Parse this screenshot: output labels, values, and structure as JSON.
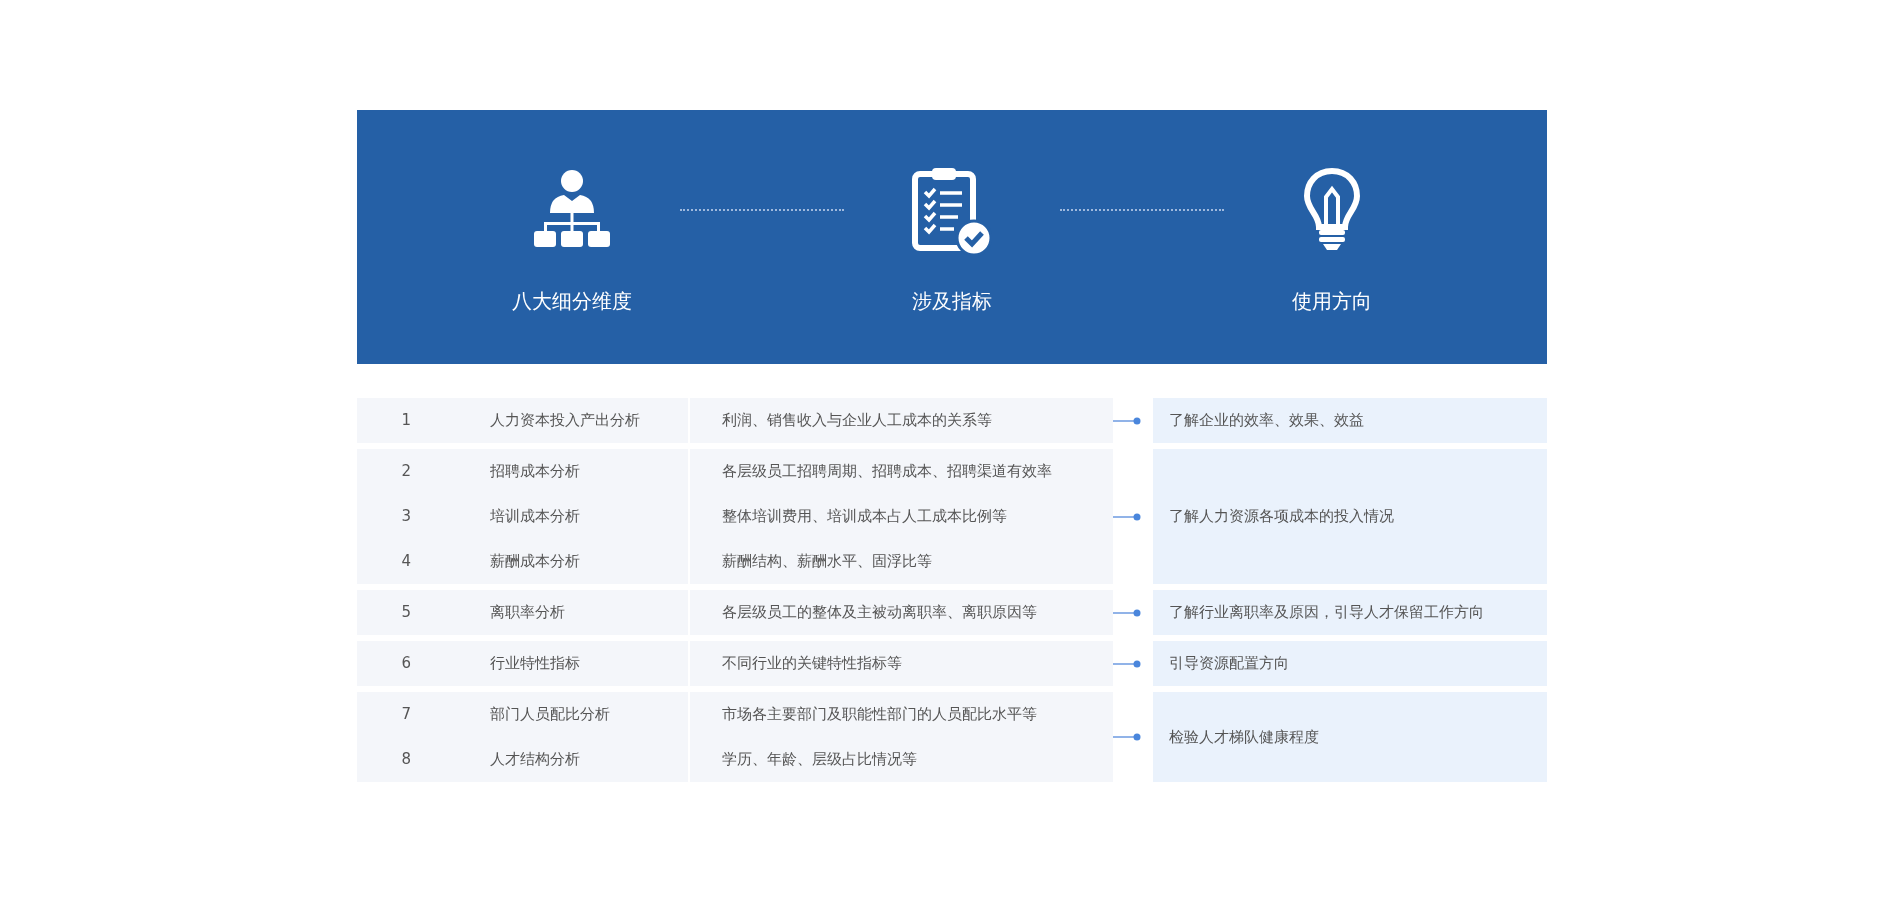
{
  "header": {
    "columns": [
      {
        "kind": "org",
        "label": "八大细分维度"
      },
      {
        "kind": "checklist",
        "label": "涉及指标"
      },
      {
        "kind": "bulb",
        "label": "使用方向"
      }
    ]
  },
  "groups": [
    {
      "rows": [
        {
          "number": "1",
          "name": "人力资本投入产出分析",
          "indicator": "利润、销售收入与企业人工成本的关系等"
        }
      ],
      "usage": "了解企业的效率、效果、效益"
    },
    {
      "rows": [
        {
          "number": "2",
          "name": "招聘成本分析",
          "indicator": "各层级员工招聘周期、招聘成本、招聘渠道有效率"
        },
        {
          "number": "3",
          "name": "培训成本分析",
          "indicator": "整体培训费用、培训成本占人工成本比例等"
        },
        {
          "number": "4",
          "name": "薪酬成本分析",
          "indicator": "薪酬结构、薪酬水平、固浮比等"
        }
      ],
      "usage": "了解人力资源各项成本的投入情况"
    },
    {
      "rows": [
        {
          "number": "5",
          "name": "离职率分析",
          "indicator": "各层级员工的整体及主被动离职率、离职原因等"
        }
      ],
      "usage": "了解行业离职率及原因，引导人才保留工作方向"
    },
    {
      "rows": [
        {
          "number": "6",
          "name": "行业特性指标",
          "indicator": "不同行业的关键特性指标等"
        }
      ],
      "usage": "引导资源配置方向"
    },
    {
      "rows": [
        {
          "number": "7",
          "name": "部门人员配比分析",
          "indicator": "市场各主要部门及职能性部门的人员配比水平等"
        },
        {
          "number": "8",
          "name": "人才结构分析",
          "indicator": "学历、年龄、层级占比情况等"
        }
      ],
      "usage": "检验人才梯队健康程度"
    }
  ]
}
